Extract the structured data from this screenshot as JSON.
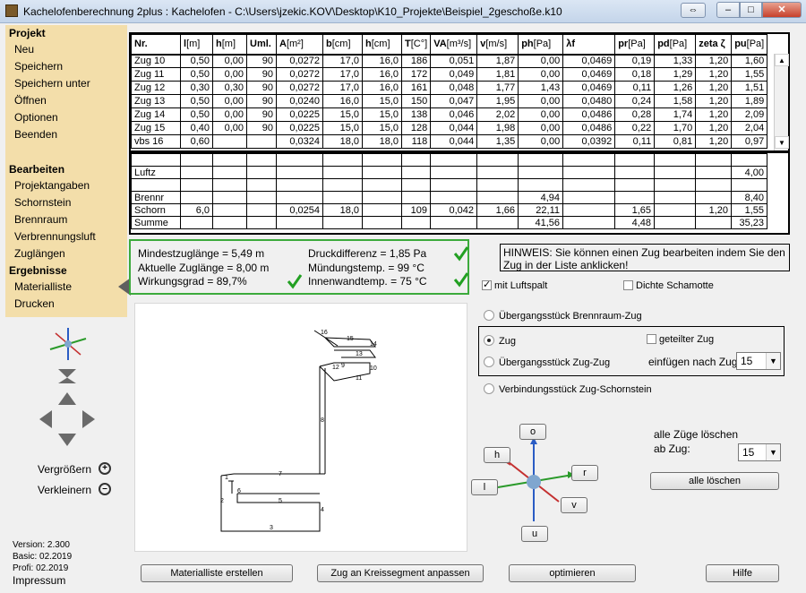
{
  "window": {
    "title": "Kachelofenberechnung 2plus : Kachelofen - C:\\Users\\jzekic.KOV\\Desktop\\K10_Projekte\\Beispiel_2geschoße.k10",
    "restore_extra": "⇔",
    "min": "–",
    "max": "□",
    "close": "✕"
  },
  "sidebar": {
    "projekt_heading": "Projekt",
    "projekt_items": [
      "Neu",
      "Speichern",
      "Speichern unter",
      "Öffnen",
      "Optionen",
      "Beenden"
    ],
    "bearbeiten_heading": "Bearbeiten",
    "bearbeiten_items": [
      "Projektangaben",
      "Schornstein",
      "Brennraum",
      "Verbrennungsluft",
      "Zuglängen"
    ],
    "ergebnisse_heading": "Ergebnisse",
    "ergebnisse_items": [
      "Materialliste",
      "Drucken"
    ]
  },
  "zoom": {
    "in_label": "Vergrößern",
    "out_label": "Verkleinern"
  },
  "version": {
    "version": "Version: 2.300",
    "basic": "Basic: 02.2019",
    "profi": "Profi: 02.2019",
    "impressum": "Impressum"
  },
  "table": {
    "headers": [
      {
        "bold": "Nr.",
        "unit": ""
      },
      {
        "bold": "l",
        "unit": "[m]"
      },
      {
        "bold": "h",
        "unit": "[m]"
      },
      {
        "bold": "Uml.",
        "unit": ""
      },
      {
        "bold": "A",
        "unit": "[m²]"
      },
      {
        "bold": "b",
        "unit": "[cm]"
      },
      {
        "bold": "h",
        "unit": "[cm]"
      },
      {
        "bold": "T",
        "unit": "[C°]"
      },
      {
        "bold": "VA",
        "unit": "[m³/s]"
      },
      {
        "bold": "v",
        "unit": "[m/s]"
      },
      {
        "bold": "ph",
        "unit": "[Pa]"
      },
      {
        "bold": "λf",
        "unit": ""
      },
      {
        "bold": "pr",
        "unit": "[Pa]"
      },
      {
        "bold": "pd",
        "unit": "[Pa]"
      },
      {
        "bold": "zeta ζ",
        "unit": ""
      },
      {
        "bold": "pu",
        "unit": "[Pa]"
      }
    ],
    "rows": [
      [
        "Zug 10",
        "0,50",
        "0,00",
        "90",
        "0,0272",
        "17,0",
        "16,0",
        "186",
        "0,051",
        "1,87",
        "0,00",
        "0,0469",
        "0,19",
        "1,33",
        "1,20",
        "1,60"
      ],
      [
        "Zug 11",
        "0,50",
        "0,00",
        "90",
        "0,0272",
        "17,0",
        "16,0",
        "172",
        "0,049",
        "1,81",
        "0,00",
        "0,0469",
        "0,18",
        "1,29",
        "1,20",
        "1,55"
      ],
      [
        "Zug 12",
        "0,30",
        "0,30",
        "90",
        "0,0272",
        "17,0",
        "16,0",
        "161",
        "0,048",
        "1,77",
        "1,43",
        "0,0469",
        "0,11",
        "1,26",
        "1,20",
        "1,51"
      ],
      [
        "Zug 13",
        "0,50",
        "0,00",
        "90",
        "0,0240",
        "16,0",
        "15,0",
        "150",
        "0,047",
        "1,95",
        "0,00",
        "0,0480",
        "0,24",
        "1,58",
        "1,20",
        "1,89"
      ],
      [
        "Zug 14",
        "0,50",
        "0,00",
        "90",
        "0,0225",
        "15,0",
        "15,0",
        "138",
        "0,046",
        "2,02",
        "0,00",
        "0,0486",
        "0,28",
        "1,74",
        "1,20",
        "2,09"
      ],
      [
        "Zug 15",
        "0,40",
        "0,00",
        "90",
        "0,0225",
        "15,0",
        "15,0",
        "128",
        "0,044",
        "1,98",
        "0,00",
        "0,0486",
        "0,22",
        "1,70",
        "1,20",
        "2,04"
      ],
      [
        "vbs  16",
        "0,60",
        "",
        "",
        "0,0324",
        "18,0",
        "18,0",
        "118",
        "0,044",
        "1,35",
        "0,00",
        "0,0392",
        "0,11",
        "0,81",
        "1,20",
        "0,97"
      ]
    ],
    "summary_rows": [
      [
        "",
        "",
        "",
        "",
        "",
        "",
        "",
        "",
        "",
        "",
        "",
        "",
        "",
        "",
        "",
        ""
      ],
      [
        "Luftz",
        "",
        "",
        "",
        "",
        "",
        "",
        "",
        "",
        "",
        "",
        "",
        "",
        "",
        "",
        "4,00"
      ],
      [
        "",
        "",
        "",
        "",
        "",
        "",
        "",
        "",
        "",
        "",
        "",
        "",
        "",
        "",
        "",
        ""
      ],
      [
        "Brennr",
        "",
        "",
        "",
        "",
        "",
        "",
        "",
        "",
        "",
        "4,94",
        "",
        "",
        "",
        "",
        "8,40"
      ],
      [
        "Schorn",
        "6,0",
        "",
        "",
        "0,0254",
        "18,0",
        "",
        "109",
        "0,042",
        "1,66",
        "22,11",
        "",
        "1,65",
        "",
        "1,20",
        "1,55"
      ],
      [
        "Summe",
        "",
        "",
        "",
        "",
        "",
        "",
        "",
        "",
        "",
        "41,56",
        "",
        "4,48",
        "",
        "",
        "35,23"
      ]
    ],
    "scroll_up": "▲",
    "scroll_down": "▼"
  },
  "results": {
    "mindestzuglaenge": "Mindestzuglänge = 5,49 m",
    "aktuelle_zuglaenge": "Aktuelle Zuglänge = 8,00 m",
    "wirkungsgrad": "Wirkungsgrad = 89,7%",
    "druckdifferenz": "Druckdifferenz = 1,85 Pa",
    "muendungstemp": "Mündungstemp. = 99 °C",
    "innenwandtemp": "Innenwandtemp. = 75 °C",
    "check_color": "#22a022"
  },
  "hint": "HINWEIS: Sie können einen Zug bearbeiten indem Sie den Zug in der Liste anklicken!",
  "options": {
    "luftspalt": "mit Luftspalt",
    "schamotte": "Dichte Schamotte",
    "radio_brennraum": "Übergangsstück Brennraum-Zug",
    "radio_zug": "Zug",
    "radio_uebergang": "Übergangsstück Zug-Zug",
    "radio_verbindung": "Verbindungsstück Zug-Schornstein",
    "geteilter_zug": "geteilter Zug",
    "einfuegen_label": "einfügen nach Zug",
    "einfuegen_value": "15",
    "loeschen_label_1": "alle Züge löschen",
    "loeschen_label_2": "ab Zug:",
    "loeschen_value": "15",
    "loeschen_button": "alle löschen",
    "dropdown_arrow": "▼"
  },
  "direction_buttons": {
    "o": "o",
    "h": "h",
    "r": "r",
    "l": "l",
    "v": "v",
    "u": "u"
  },
  "drawing_labels": [
    "16",
    "15",
    "14",
    "13",
    "12",
    "9",
    "10",
    "11",
    "8",
    "7",
    "1",
    "6",
    "5",
    "4",
    "2",
    "3"
  ],
  "bottom_buttons": {
    "materialliste": "Materialliste erstellen",
    "kreissegment": "Zug an Kreissegment anpassen",
    "optimieren": "optimieren",
    "hilfe": "Hilfe"
  }
}
